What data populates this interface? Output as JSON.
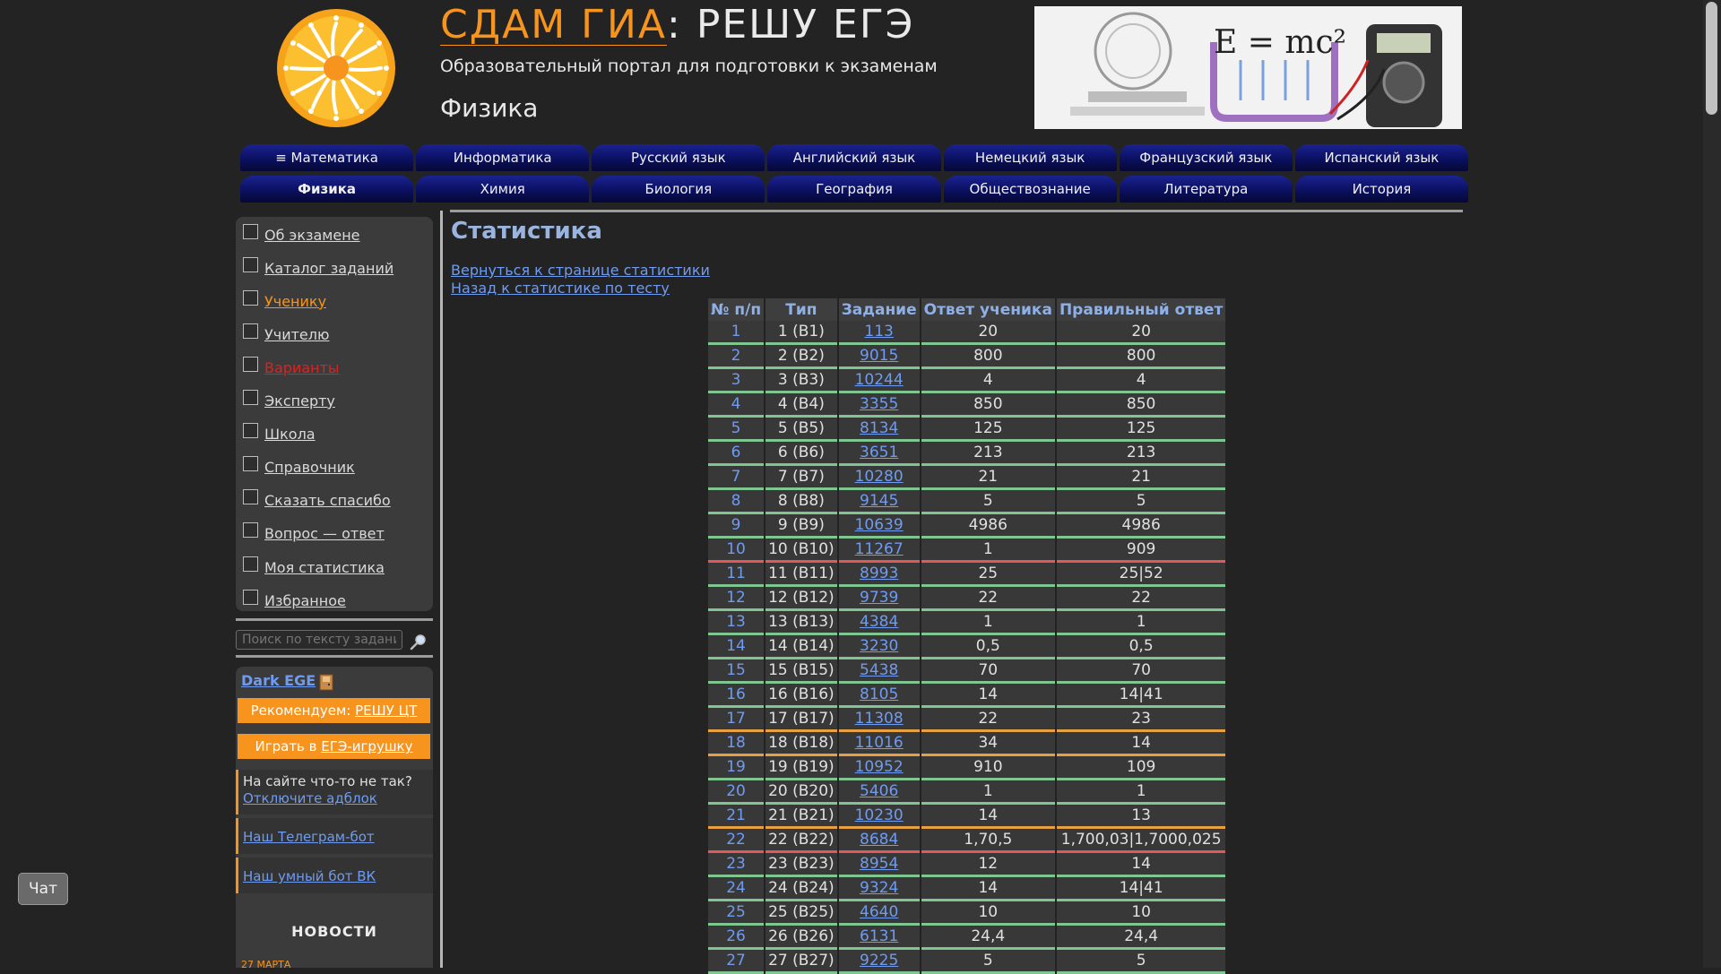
{
  "header": {
    "brand": "СДАМ ГИА",
    "separator": ":",
    "site": "РЕШУ ЕГЭ",
    "subtitle": "Образовательный портал для подготовки к экзаменам",
    "subject": "Физика",
    "banner_formula": "E = mc²"
  },
  "nav": {
    "row1": [
      "≡ Математика",
      "Информатика",
      "Русский язык",
      "Английский язык",
      "Немецкий язык",
      "Французский язык",
      "Испанский язык"
    ],
    "row2": [
      "Физика",
      "Химия",
      "Биология",
      "География",
      "Обществознание",
      "Литература",
      "История"
    ],
    "active": "Физика"
  },
  "sidebar": {
    "menu": [
      {
        "label": "Об экзамене",
        "style": "normal"
      },
      {
        "label": "Каталог заданий",
        "style": "normal"
      },
      {
        "label": "Ученику",
        "style": "orange"
      },
      {
        "label": "Учителю",
        "style": "normal"
      },
      {
        "label": "Варианты",
        "style": "red"
      },
      {
        "label": "Эксперту",
        "style": "normal"
      },
      {
        "label": "Школа",
        "style": "normal"
      },
      {
        "label": "Справочник",
        "style": "normal"
      },
      {
        "label": "Сказать спасибо",
        "style": "normal"
      },
      {
        "label": "Вопрос — ответ",
        "style": "normal"
      },
      {
        "label": "Моя статистика",
        "style": "normal"
      },
      {
        "label": "Избранное",
        "style": "normal"
      }
    ],
    "search_placeholder": "Поиск по тексту задания",
    "dark_ege": "Dark EGE",
    "recommend_prefix": "Рекомендуем: ",
    "recommend_link": "РЕШУ ЦТ",
    "play_prefix": "Играть в ",
    "play_link": "ЕГЭ-игрушку",
    "adblock_question": "На сайте что-то не так?",
    "adblock_link": "Отключите адблок",
    "telegram_link": "Наш Телеграм-бот",
    "vk_link": "Наш умный бот ВК",
    "news_heading": "НОВОСТИ",
    "news_date": "27 МАРТА"
  },
  "main": {
    "title": "Статистика",
    "back_link_1": "Вернуться к странице статистики",
    "back_link_2": "Назад к статистике по тесту",
    "table": {
      "headers": [
        "№ п/п",
        "Тип",
        "Задание",
        "Ответ ученика",
        "Правильный ответ"
      ],
      "rows": [
        {
          "n": "1",
          "type": "1 (B1)",
          "task": "113",
          "answer": "20",
          "correct": "20",
          "status": "ok"
        },
        {
          "n": "2",
          "type": "2 (B2)",
          "task": "9015",
          "answer": "800",
          "correct": "800",
          "status": "ok"
        },
        {
          "n": "3",
          "type": "3 (B3)",
          "task": "10244",
          "answer": "4",
          "correct": "4",
          "status": "ok"
        },
        {
          "n": "4",
          "type": "4 (B4)",
          "task": "3355",
          "answer": "850",
          "correct": "850",
          "status": "ok"
        },
        {
          "n": "5",
          "type": "5 (B5)",
          "task": "8134",
          "answer": "125",
          "correct": "125",
          "status": "ok"
        },
        {
          "n": "6",
          "type": "6 (B6)",
          "task": "3651",
          "answer": "213",
          "correct": "213",
          "status": "ok"
        },
        {
          "n": "7",
          "type": "7 (B7)",
          "task": "10280",
          "answer": "21",
          "correct": "21",
          "status": "ok"
        },
        {
          "n": "8",
          "type": "8 (B8)",
          "task": "9145",
          "answer": "5",
          "correct": "5",
          "status": "ok"
        },
        {
          "n": "9",
          "type": "9 (B9)",
          "task": "10639",
          "answer": "4986",
          "correct": "4986",
          "status": "ok"
        },
        {
          "n": "10",
          "type": "10 (B10)",
          "task": "11267",
          "answer": "1",
          "correct": "909",
          "status": "wrong"
        },
        {
          "n": "11",
          "type": "11 (B11)",
          "task": "8993",
          "answer": "25",
          "correct": "25|52",
          "status": "ok"
        },
        {
          "n": "12",
          "type": "12 (B12)",
          "task": "9739",
          "answer": "22",
          "correct": "22",
          "status": "ok"
        },
        {
          "n": "13",
          "type": "13 (B13)",
          "task": "4384",
          "answer": "1",
          "correct": "1",
          "status": "ok"
        },
        {
          "n": "14",
          "type": "14 (B14)",
          "task": "3230",
          "answer": "0,5",
          "correct": "0,5",
          "status": "ok"
        },
        {
          "n": "15",
          "type": "15 (B15)",
          "task": "5438",
          "answer": "70",
          "correct": "70",
          "status": "ok"
        },
        {
          "n": "16",
          "type": "16 (B16)",
          "task": "8105",
          "answer": "14",
          "correct": "14|41",
          "status": "ok"
        },
        {
          "n": "17",
          "type": "17 (B17)",
          "task": "11308",
          "answer": "22",
          "correct": "23",
          "status": "partial"
        },
        {
          "n": "18",
          "type": "18 (B18)",
          "task": "11016",
          "answer": "34",
          "correct": "14",
          "status": "partial"
        },
        {
          "n": "19",
          "type": "19 (B19)",
          "task": "10952",
          "answer": "910",
          "correct": "109",
          "status": "ok"
        },
        {
          "n": "20",
          "type": "20 (B20)",
          "task": "5406",
          "answer": "1",
          "correct": "1",
          "status": "ok"
        },
        {
          "n": "21",
          "type": "21 (B21)",
          "task": "10230",
          "answer": "14",
          "correct": "13",
          "status": "partial"
        },
        {
          "n": "22",
          "type": "22 (B22)",
          "task": "8684",
          "answer": "1,70,5",
          "correct": "1,700,03|1,7000,025",
          "status": "wrong"
        },
        {
          "n": "23",
          "type": "23 (B23)",
          "task": "8954",
          "answer": "12",
          "correct": "14",
          "status": "ok"
        },
        {
          "n": "24",
          "type": "24 (B24)",
          "task": "9324",
          "answer": "14",
          "correct": "14|41",
          "status": "ok"
        },
        {
          "n": "25",
          "type": "25 (B25)",
          "task": "4640",
          "answer": "10",
          "correct": "10",
          "status": "ok"
        },
        {
          "n": "26",
          "type": "26 (B26)",
          "task": "6131",
          "answer": "24,4",
          "correct": "24,4",
          "status": "ok"
        },
        {
          "n": "27",
          "type": "27 (B27)",
          "task": "9225",
          "answer": "5",
          "correct": "5",
          "status": "ok"
        }
      ]
    }
  },
  "chat_label": "Чат",
  "colors": {
    "background": "#232323",
    "accent_orange": "#f7941d",
    "link_blue": "#6f9bf0",
    "tab_navy": "#0b1060",
    "row_ok": "#7fc690",
    "row_wrong": "#e05a5a",
    "row_partial": "#e8a040"
  }
}
